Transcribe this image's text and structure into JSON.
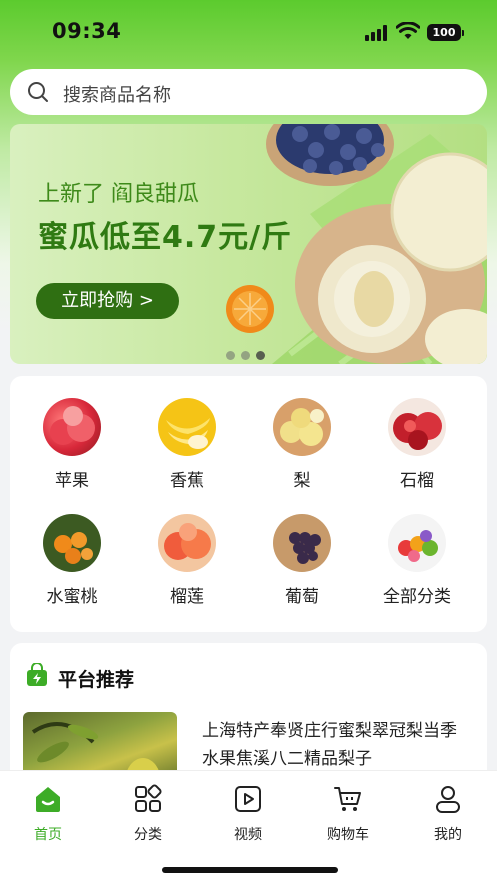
{
  "status_bar": {
    "time": "09:34",
    "battery": "100"
  },
  "search": {
    "placeholder": "搜索商品名称"
  },
  "banner": {
    "subtitle": "上新了 阎良甜瓜",
    "title": "蜜瓜低至4.7元/斤",
    "button_label": "立即抢购 >"
  },
  "categories": [
    {
      "label": "苹果",
      "icon": "apple"
    },
    {
      "label": "香蕉",
      "icon": "banana"
    },
    {
      "label": "梨",
      "icon": "pear"
    },
    {
      "label": "石榴",
      "icon": "pomegranate"
    },
    {
      "label": "水蜜桃",
      "icon": "orange-tree"
    },
    {
      "label": "榴莲",
      "icon": "peach"
    },
    {
      "label": "葡萄",
      "icon": "grapes"
    },
    {
      "label": "全部分类",
      "icon": "mixed-fruit"
    }
  ],
  "recommend": {
    "title": "平台推荐",
    "items": [
      {
        "description": "上海特产奉贤庄行蜜梨翠冠梨当季水果焦溪八二精品梨子"
      }
    ]
  },
  "tabs": [
    {
      "label": "首页",
      "icon": "home-icon",
      "active": true
    },
    {
      "label": "分类",
      "icon": "category-icon",
      "active": false
    },
    {
      "label": "视频",
      "icon": "video-icon",
      "active": false
    },
    {
      "label": "购物车",
      "icon": "cart-icon",
      "active": false
    },
    {
      "label": "我的",
      "icon": "profile-icon",
      "active": false
    }
  ],
  "colors": {
    "accent": "#3dac27",
    "banner_button": "#2f6f12",
    "brand_green": "#5ccb2e"
  }
}
